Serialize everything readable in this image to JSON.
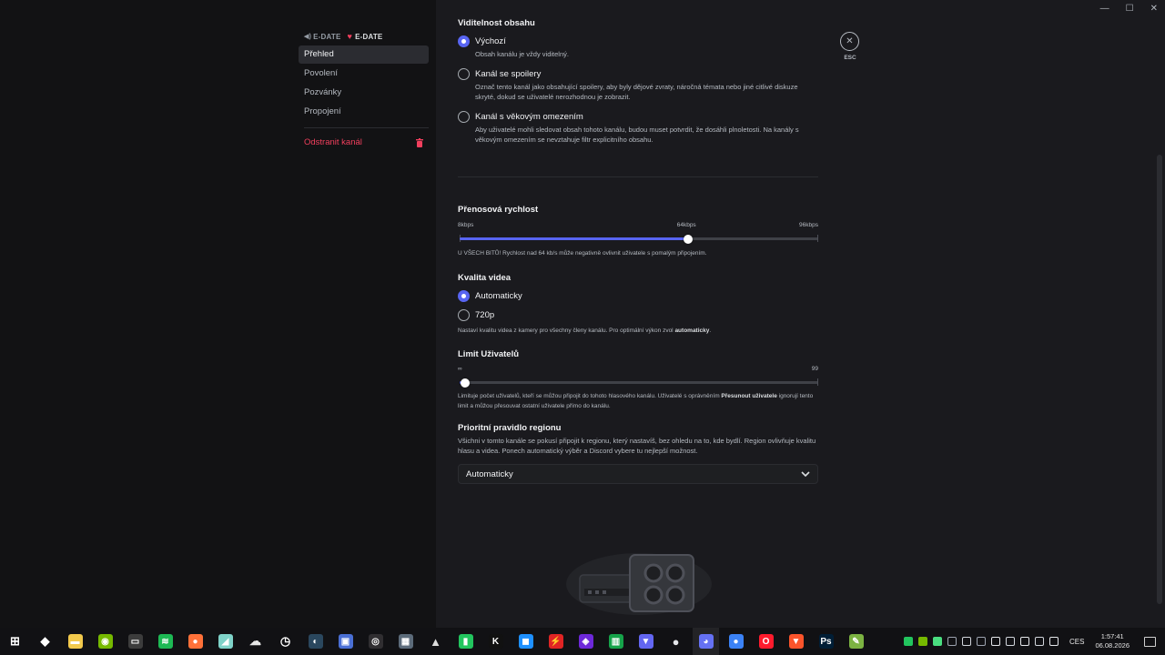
{
  "window": {
    "controls": [
      "—",
      "☐",
      "✕"
    ]
  },
  "sidebar": {
    "server_left": "E-DATE",
    "server_right": "E-DATE",
    "items": [
      {
        "label": "Přehled",
        "active": true
      },
      {
        "label": "Povolení"
      },
      {
        "label": "Pozvánky"
      },
      {
        "label": "Propojení"
      }
    ],
    "delete_label": "Odstranit kanál",
    "delete_color": "#f23f5d"
  },
  "content_visibility": {
    "title": "Viditelnost obsahu",
    "options": [
      {
        "label": "Výchozí",
        "desc": "Obsah kanálu je vždy viditelný.",
        "selected": true
      },
      {
        "label": "Kanál se spoilery",
        "desc": "Označ tento kanál jako obsahující spoilery, aby byly dějové zvraty, náročná témata nebo jiné citlivé diskuze skryté, dokud se uživatelé nerozhodnou je zobrazit.",
        "selected": false
      },
      {
        "label": "Kanál s věkovým omezením",
        "desc": "Aby uživatelé mohli sledovat obsah tohoto kanálu, budou muset potvrdit, že dosáhli plnoletosti. Na kanály s věkovým omezením se nevztahuje filtr explicitního obsahu.",
        "selected": false
      }
    ]
  },
  "bitrate": {
    "title": "Přenosová rychlost",
    "min_label": "8kbps",
    "value_label": "64kbps",
    "max_label": "96kbps",
    "min": 8,
    "max": 96,
    "value": 64,
    "hint": "U VŠECH BITŮ! Rychlost nad 64 kb/s může negativně ovlivnit uživatele s pomalým připojením."
  },
  "video_quality": {
    "title": "Kvalita videa",
    "options": [
      {
        "label": "Automaticky",
        "selected": true
      },
      {
        "label": "720p",
        "selected": false
      }
    ],
    "hint_prefix": "Nastaví kvalitu videa z kamery pro všechny členy kanálu. Pro optimální výkon zvol ",
    "hint_bold": "automaticky",
    "hint_suffix": "."
  },
  "user_limit": {
    "title": "Limit Uživatelů",
    "min_label": "∞",
    "max_label": "99",
    "value": 0,
    "max": 99,
    "hint_prefix": "Limituje počet uživatelů, kteří se můžou připojit do tohoto hlasového kanálu. Uživatelé s oprávněním ",
    "hint_bold": "Přesunout uživatele",
    "hint_suffix": " ignorují tento limit a můžou přesouvat ostatní uživatele přímo do kanálu."
  },
  "region": {
    "title": "Prioritní pravidlo regionu",
    "desc": "Všichni v tomto kanále se pokusí připojit k regionu, který nastavíš, bez ohledu na to, kde bydlí. Region ovlivňuje kvalitu hlasu a videa. Ponech automatický výběr a Discord vybere tu nejlepší možnost.",
    "selected": "Automaticky"
  },
  "close": {
    "icon": "✕",
    "label": "ESC"
  },
  "accent_color": "#5865f2",
  "taskbar": {
    "apps": [
      {
        "name": "windows-start-icon",
        "color": "#ffffff",
        "glyph": "⊞"
      },
      {
        "name": "security-shield-icon",
        "color": "#ffffff",
        "glyph": "◆"
      },
      {
        "name": "file-explorer-icon",
        "color": "#f2c94c",
        "glyph": "▬"
      },
      {
        "name": "nvidia-icon",
        "color": "#76b900",
        "glyph": "◉"
      },
      {
        "name": "terminal-icon",
        "color": "#3c3c3c",
        "glyph": "▭"
      },
      {
        "name": "spotify-icon",
        "color": "#1db954",
        "glyph": "≋"
      },
      {
        "name": "firefox-icon",
        "color": "#ff7139",
        "glyph": "●"
      },
      {
        "name": "app-cyan-icon",
        "color": "#7fd3c9",
        "glyph": "◢"
      },
      {
        "name": "cloud-app-icon",
        "color": "#e8e8e8",
        "glyph": "☁"
      },
      {
        "name": "clock-app-icon",
        "color": "#ffffff",
        "glyph": "◷"
      },
      {
        "name": "steam-icon",
        "color": "#2a475e",
        "glyph": "◐"
      },
      {
        "name": "remote-desktop-icon",
        "color": "#4a6fd4",
        "glyph": "▣"
      },
      {
        "name": "obs-icon",
        "color": "#302e31",
        "glyph": "◎"
      },
      {
        "name": "calculator-icon",
        "color": "#5c6b7a",
        "glyph": "▦"
      },
      {
        "name": "affinity-icon",
        "color": "#dddddd",
        "glyph": "▲"
      },
      {
        "name": "green-app-icon",
        "color": "#22c55e",
        "glyph": "▮"
      },
      {
        "name": "k-app-icon",
        "color": "#111111",
        "glyph": "K"
      },
      {
        "name": "blue-app-icon",
        "color": "#1e90ff",
        "glyph": "◼"
      },
      {
        "name": "red-bolt-icon",
        "color": "#e02424",
        "glyph": "⚡"
      },
      {
        "name": "purple-app-icon",
        "color": "#6d28d9",
        "glyph": "◈"
      },
      {
        "name": "stats-app-icon",
        "color": "#16a34a",
        "glyph": "▥"
      },
      {
        "name": "vpn-icon",
        "color": "#6366f1",
        "glyph": "▼"
      },
      {
        "name": "white-circle-icon",
        "color": "#e5e7eb",
        "glyph": "●"
      },
      {
        "name": "discord-icon",
        "color": "#5865f2",
        "glyph": "◕",
        "active": true
      },
      {
        "name": "blue-circle-icon",
        "color": "#3b82f6",
        "glyph": "●"
      },
      {
        "name": "opera-icon",
        "color": "#ff1b2d",
        "glyph": "O"
      },
      {
        "name": "brave-icon",
        "color": "#fb542b",
        "glyph": "▼"
      },
      {
        "name": "photoshop-icon",
        "color": "#001e36",
        "glyph": "Ps"
      },
      {
        "name": "notepad-icon",
        "color": "#7cb342",
        "glyph": "✎"
      }
    ],
    "tray_colors": [
      "#22c55e",
      "#76b900",
      "#4ade80",
      "#9ca3af",
      "#d1d5db",
      "#9ca3af",
      "#e5e7eb",
      "#d1d5db",
      "#e5e7eb",
      "#d1d5db",
      "#e5e7eb"
    ],
    "language": "CES",
    "time": "1:57:41",
    "date": "06.08.2026"
  }
}
